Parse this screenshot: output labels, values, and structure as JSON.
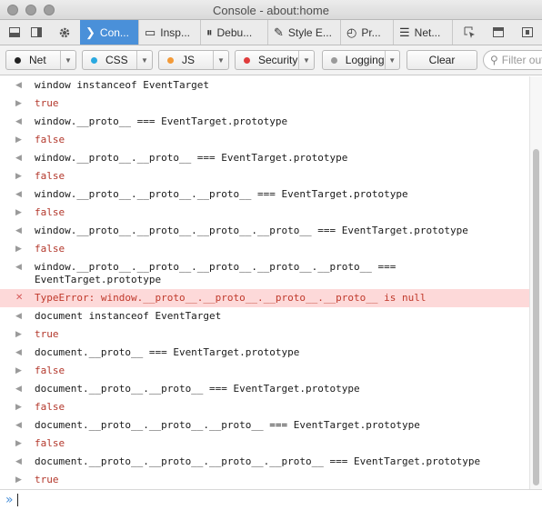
{
  "window": {
    "title": "Console - about:home"
  },
  "toolbar": {
    "tabs": [
      {
        "label": "Con...",
        "icon": "console-icon"
      },
      {
        "label": "Insp...",
        "icon": "inspector-icon"
      },
      {
        "label": "Debu...",
        "icon": "debugger-icon"
      },
      {
        "label": "Style E...",
        "icon": "style-editor-icon"
      },
      {
        "label": "Pr...",
        "icon": "performance-icon"
      },
      {
        "label": "Net...",
        "icon": "network-icon"
      }
    ]
  },
  "filters": {
    "net": {
      "label": "Net",
      "color": "#222222"
    },
    "css": {
      "label": "CSS",
      "color": "#2aa9e0"
    },
    "js": {
      "label": "JS",
      "color": "#f39a38"
    },
    "security": {
      "label": "Security",
      "color": "#e03c3c"
    },
    "logging": {
      "label": "Logging",
      "color": "#9a9a9a"
    },
    "clear": "Clear",
    "search_placeholder": "Filter out"
  },
  "messages": [
    {
      "type": "in",
      "text": "window instanceof EventTarget"
    },
    {
      "type": "out",
      "text": "true"
    },
    {
      "type": "in",
      "text": "window.__proto__ === EventTarget.prototype"
    },
    {
      "type": "out",
      "text": "false"
    },
    {
      "type": "in",
      "text": "window.__proto__.__proto__ === EventTarget.prototype"
    },
    {
      "type": "out",
      "text": "false"
    },
    {
      "type": "in",
      "text": "window.__proto__.__proto__.__proto__ === EventTarget.prototype"
    },
    {
      "type": "out",
      "text": "false"
    },
    {
      "type": "in",
      "text": "window.__proto__.__proto__.__proto__.__proto__ === EventTarget.prototype"
    },
    {
      "type": "out",
      "text": "false"
    },
    {
      "type": "in",
      "text": "window.__proto__.__proto__.__proto__.__proto__.__proto__ ===\nEventTarget.prototype"
    },
    {
      "type": "err",
      "text": "TypeError: window.__proto__.__proto__.__proto__.__proto__ is null"
    },
    {
      "type": "in",
      "text": "document instanceof EventTarget"
    },
    {
      "type": "out",
      "text": "true"
    },
    {
      "type": "in",
      "text": "document.__proto__ === EventTarget.prototype"
    },
    {
      "type": "out",
      "text": "false"
    },
    {
      "type": "in",
      "text": "document.__proto__.__proto__ === EventTarget.prototype"
    },
    {
      "type": "out",
      "text": "false"
    },
    {
      "type": "in",
      "text": "document.__proto__.__proto__.__proto__ === EventTarget.prototype"
    },
    {
      "type": "out",
      "text": "false"
    },
    {
      "type": "in",
      "text": "document.__proto__.__proto__.__proto__.__proto__ === EventTarget.prototype"
    },
    {
      "type": "out",
      "text": "true"
    }
  ]
}
